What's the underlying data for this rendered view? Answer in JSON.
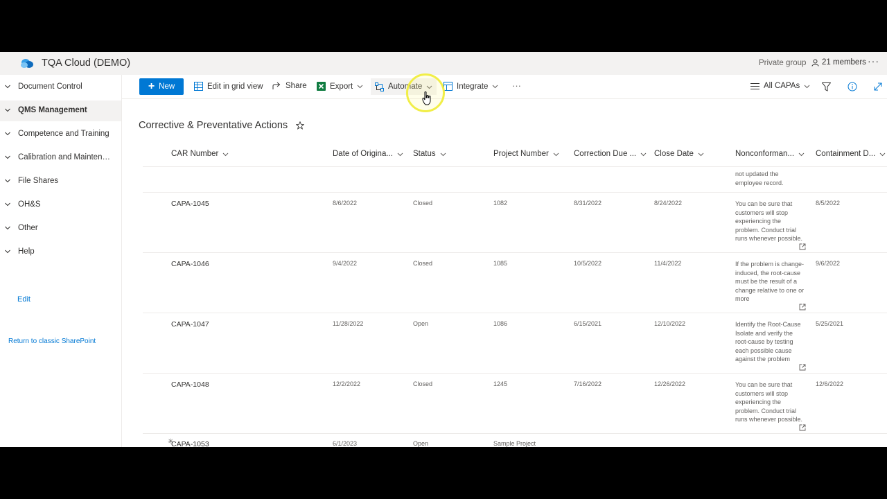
{
  "site": {
    "title": "TQA Cloud (DEMO)",
    "privacy": "Private group",
    "members": "21 members",
    "more": "···"
  },
  "nav": {
    "items": [
      {
        "label": "Document Control"
      },
      {
        "label": "QMS Management"
      },
      {
        "label": "Competence and Training"
      },
      {
        "label": "Calibration and Maintena..."
      },
      {
        "label": "File Shares"
      },
      {
        "label": "OH&S"
      },
      {
        "label": "Other"
      },
      {
        "label": "Help"
      }
    ],
    "edit": "Edit",
    "return": "Return to classic SharePoint"
  },
  "commands": {
    "new": "New",
    "grid": "Edit in grid view",
    "share": "Share",
    "export": "Export",
    "automate": "Automate",
    "integrate": "Integrate",
    "more": "···",
    "view": "All CAPAs"
  },
  "list": {
    "title": "Corrective & Preventative Actions",
    "columns": [
      "CAR Number",
      "Date of Origina...",
      "Status",
      "Project Number",
      "Correction Due ...",
      "Close Date",
      "Nonconforman...",
      "Containment D..."
    ],
    "partial_row": {
      "nonconformance": "not updated the employee record."
    },
    "rows": [
      {
        "car": "CAPA-1045",
        "date": "8/6/2022",
        "status": "Closed",
        "project": "1082",
        "correction": "8/31/2022",
        "close": "8/24/2022",
        "nonconformance": "You can be sure that customers will stop experiencing the problem. Conduct trial runs whenever possible.",
        "containment": "8/5/2022"
      },
      {
        "car": "CAPA-1046",
        "date": "9/4/2022",
        "status": "Closed",
        "project": "1085",
        "correction": "10/5/2022",
        "close": "11/4/2022",
        "nonconformance": "If the problem is change-induced, the root-cause must be the result of a change relative to one or more",
        "containment": "9/6/2022"
      },
      {
        "car": "CAPA-1047",
        "date": "11/28/2022",
        "status": "Open",
        "project": "1086",
        "correction": "6/15/2021",
        "close": "12/10/2022",
        "nonconformance": "Identify the Root-Cause Isolate and verify the root-cause by testing each possible cause against the problem",
        "containment": "5/25/2021"
      },
      {
        "car": "CAPA-1048",
        "date": "12/2/2022",
        "status": "Closed",
        "project": "1245",
        "correction": "7/16/2022",
        "close": "12/26/2022",
        "nonconformance": "You can be sure that customers will stop experiencing the problem. Conduct trial runs whenever possible.",
        "containment": "12/6/2022"
      },
      {
        "car": "CAPA-1053",
        "date": "6/1/2023",
        "status": "Open",
        "project": "Sample Project",
        "correction": "",
        "close": "",
        "nonconformance": "",
        "containment": ""
      }
    ]
  },
  "colors": {
    "accent": "#0078d4",
    "header_bg": "#f3f2f1",
    "cursor_ring": "#f1ee47"
  }
}
